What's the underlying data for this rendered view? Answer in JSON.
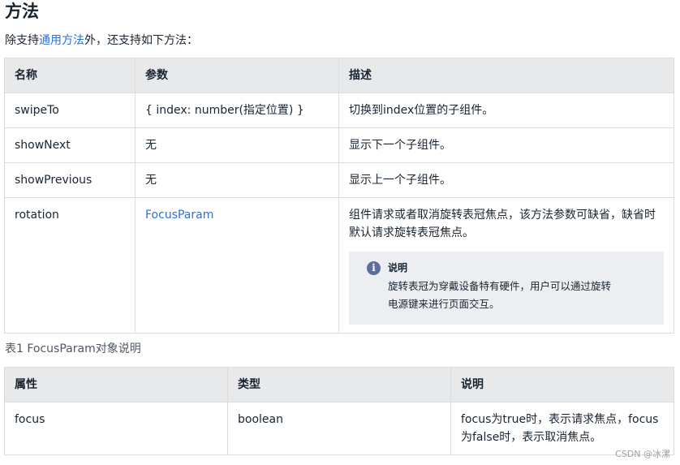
{
  "heading": "方法",
  "intro": {
    "prefix": "除支持",
    "link": "通用方法",
    "suffix": "外，还支持如下方法："
  },
  "methods_table": {
    "headers": [
      "名称",
      "参数",
      "描述"
    ],
    "rows": [
      {
        "name": "swipeTo",
        "param": "{ index: number(指定位置) }",
        "desc": "切换到index位置的子组件。"
      },
      {
        "name": "showNext",
        "param": "无",
        "desc": "显示下一个子组件。"
      },
      {
        "name": "showPrevious",
        "param": "无",
        "desc": "显示上一个子组件。"
      },
      {
        "name": "rotation",
        "param": "FocusParam",
        "desc": "组件请求或者取消旋转表冠焦点，该方法参数可缺省，缺省时默认请求旋转表冠焦点。"
      }
    ],
    "note": {
      "title": "说明",
      "line1": "旋转表冠为穿戴设备特有硬件，用户可以通过旋转",
      "line2": "电源键来进行页面交互。"
    }
  },
  "caption": "表1 FocusParam对象说明",
  "focus_table": {
    "headers": [
      "属性",
      "类型",
      "说明"
    ],
    "rows": [
      {
        "name": "focus",
        "type": "boolean",
        "desc": "focus为true时，表示请求焦点，focus为false时，表示取消焦点。"
      }
    ]
  },
  "watermark": "CSDN @冰漯"
}
